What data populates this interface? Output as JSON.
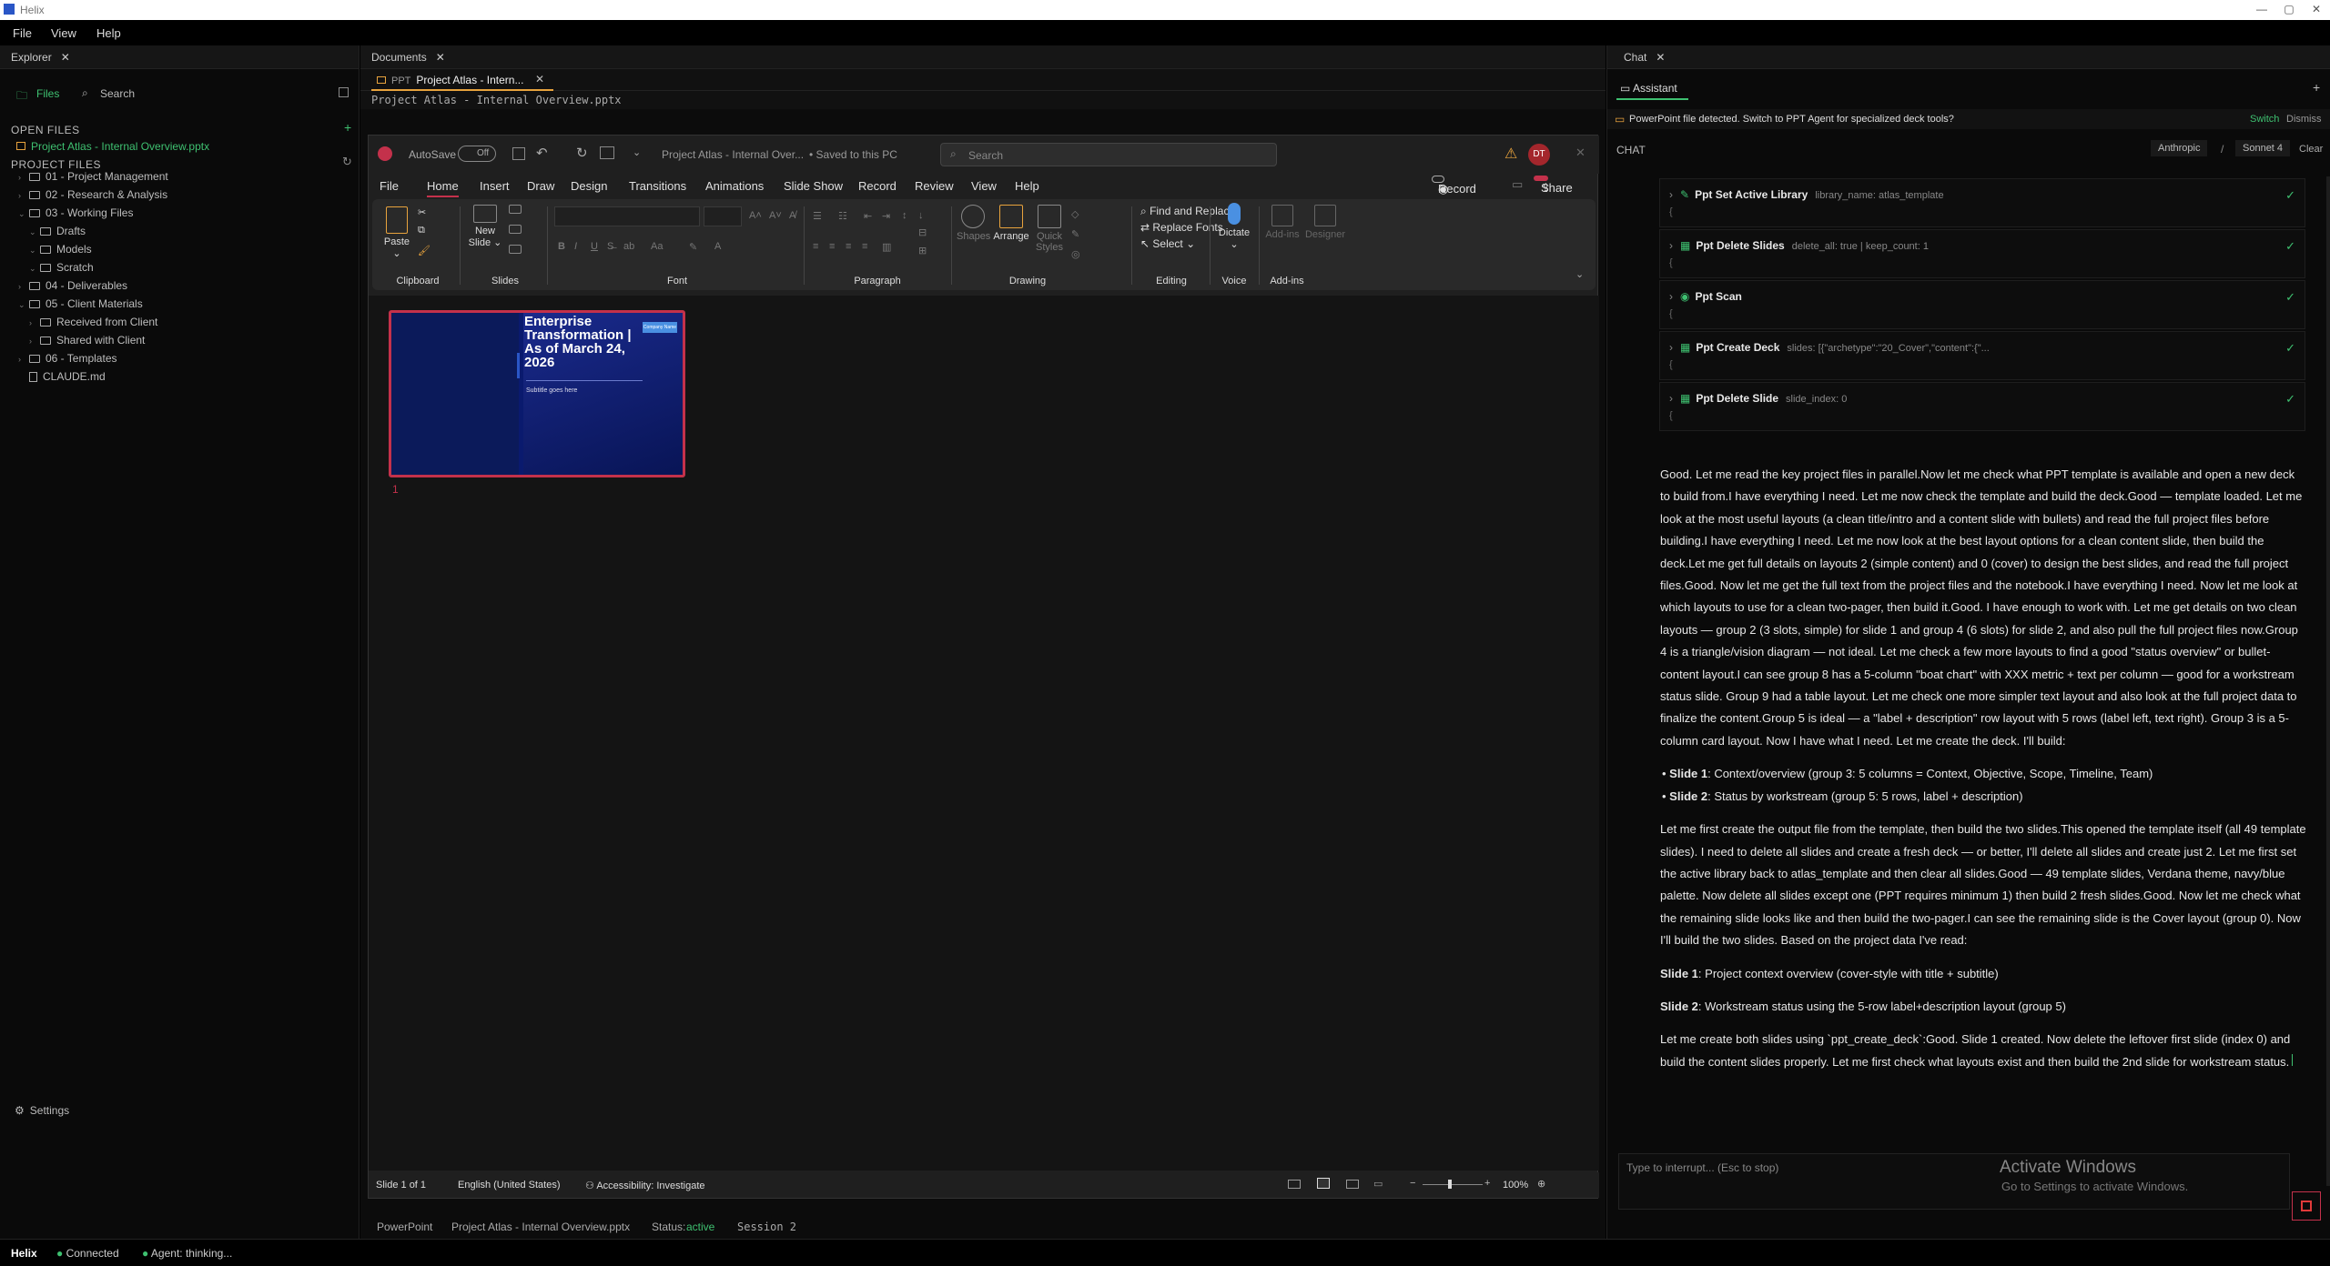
{
  "titlebar": {
    "title": "Helix",
    "minimize": "—",
    "maximize": "▢",
    "close": "✕"
  },
  "menu": [
    "File",
    "View",
    "Help"
  ],
  "explorer": {
    "tab": "Explorer",
    "files_tab": "Files",
    "search_tab": "Search",
    "open_files_label": "OPEN FILES",
    "open_file": "Project Atlas - Internal Overview.pptx",
    "project_files_label": "PROJECT FILES",
    "tree": [
      {
        "label": "01 - Project Management",
        "depth": 0,
        "type": "folder",
        "open": false
      },
      {
        "label": "02 - Research & Analysis",
        "depth": 0,
        "type": "folder",
        "open": false
      },
      {
        "label": "03 - Working Files",
        "depth": 0,
        "type": "folder",
        "open": true
      },
      {
        "label": "Drafts",
        "depth": 1,
        "type": "folder",
        "open": true
      },
      {
        "label": "Models",
        "depth": 1,
        "type": "folder",
        "open": true
      },
      {
        "label": "Scratch",
        "depth": 1,
        "type": "folder",
        "open": true
      },
      {
        "label": "04 - Deliverables",
        "depth": 0,
        "type": "folder",
        "open": false
      },
      {
        "label": "05 - Client Materials",
        "depth": 0,
        "type": "folder",
        "open": true
      },
      {
        "label": "Received from Client",
        "depth": 1,
        "type": "folder",
        "open": false
      },
      {
        "label": "Shared with Client",
        "depth": 1,
        "type": "folder",
        "open": false
      },
      {
        "label": "06 - Templates",
        "depth": 0,
        "type": "folder",
        "open": false
      },
      {
        "label": "CLAUDE.md",
        "depth": 0,
        "type": "file",
        "open": false
      }
    ],
    "settings": "Settings"
  },
  "documents": {
    "tab": "Documents",
    "doc_tab_prefix": "PPT",
    "doc_tab": "Project Atlas - Intern...",
    "path": "Project Atlas - Internal Overview.pptx"
  },
  "ppt": {
    "autosave": "AutoSave",
    "autosave_state": "Off",
    "doc_title": "Project Atlas - Internal Over...",
    "saved_state": "• Saved to this PC",
    "search_placeholder": "Search",
    "user_initials": "DT",
    "tabs": [
      "File",
      "Home",
      "Insert",
      "Draw",
      "Design",
      "Transitions",
      "Animations",
      "Slide Show",
      "Record",
      "Review",
      "View",
      "Help"
    ],
    "record_btn": "Record",
    "share_btn": "Share",
    "ribbon": {
      "paste": "Paste",
      "clipboard": "Clipboard",
      "new_slide": "New",
      "new_slide2": "Slide",
      "slides": "Slides",
      "font": "Font",
      "paragraph": "Paragraph",
      "shapes": "Shapes",
      "arrange": "Arrange",
      "quick_styles": "Quick",
      "quick_styles2": "Styles",
      "drawing": "Drawing",
      "find_replace": "Find and Replace",
      "replace_fonts": "Replace Fonts",
      "select": "Select",
      "editing": "Editing",
      "dictate": "Dictate",
      "voice": "Voice",
      "addins": "Add-ins",
      "addins_group": "Add-ins",
      "designer": "Designer"
    },
    "slide": {
      "number": "1",
      "title": "Enterprise Transformation | As of March 24, 2026",
      "subtitle": "Subtitle goes here",
      "tag": "Company Name"
    },
    "status": {
      "slide_of": "Slide 1 of 1",
      "language": "English (United States)",
      "accessibility": "Accessibility: Investigate",
      "zoom": "100%"
    }
  },
  "docstatus": {
    "app": "PowerPoint",
    "file": "Project Atlas - Internal Overview.pptx",
    "status_label": "Status:",
    "status_value": "active",
    "session": "Session 2"
  },
  "chat": {
    "tab": "Chat",
    "assistant_tab": "Assistant",
    "notice": "PowerPoint file detected. Switch to PPT Agent for specialized deck tools?",
    "switch": "Switch",
    "dismiss": "Dismiss",
    "chat_label": "CHAT",
    "provider": "Anthropic",
    "slash": "/",
    "model": "Sonnet 4",
    "clear": "Clear",
    "tools": [
      {
        "name": "Ppt Set Active Library",
        "params": "library_name: atlas_template",
        "icon": "✎"
      },
      {
        "name": "Ppt Delete Slides",
        "params": "delete_all: true | keep_count: 1",
        "icon": "▦"
      },
      {
        "name": "Ppt Scan",
        "params": "",
        "icon": "◉"
      },
      {
        "name": "Ppt Create Deck",
        "params": "slides: [{\"archetype\":\"20_Cover\",\"content\":{\"...",
        "icon": "▦"
      },
      {
        "name": "Ppt Delete Slide",
        "params": "slide_index: 0",
        "icon": "▦"
      }
    ],
    "brace": "{",
    "msg_p1": "Good. Let me read the key project files in parallel.Now let me check what PPT template is available and open a new deck to build from.I have everything I need. Let me now check the template and build the deck.Good — template loaded. Let me look at the most useful layouts (a clean title/intro and a content slide with bullets) and read the full project files before building.I have everything I need. Let me now look at the best layout options for a clean content slide, then build the deck.Let me get full details on layouts 2 (simple content) and 0 (cover) to design the best slides, and read the full project files.Good. Now let me get the full text from the project files and the notebook.I have everything I need. Now let me look at which layouts to use for a clean two-pager, then build it.Good. I have enough to work with. Let me get details on two clean layouts — group 2 (3 slots, simple) for slide 1 and group 4 (6 slots) for slide 2, and also pull the full project files now.Group 4 is a triangle/vision diagram — not ideal. Let me check a few more layouts to find a good \"status overview\" or bullet-content layout.I can see group 8 has a 5-column \"boat chart\" with XXX metric + text per column — good for a workstream status slide. Group 9 had a table layout. Let me check one more simpler text layout and also look at the full project data to finalize the content.Group 5 is ideal — a \"label + description\" row layout with 5 rows (label left, text right). Group 3 is a 5-column card layout. Now I have what I need. Let me create the deck. I'll build:",
    "bullet1_label": "Slide 1",
    "bullet1_text": ": Context/overview (group 3: 5 columns = Context, Objective, Scope, Timeline, Team)",
    "bullet2_label": "Slide 2",
    "bullet2_text": ": Status by workstream (group 5: 5 rows, label + description)",
    "msg_p2": "Let me first create the output file from the template, then build the two slides.This opened the template itself (all 49 template slides). I need to delete all slides and create a fresh deck — or better, I'll delete all slides and create just 2. Let me first set the active library back to atlas_template and then clear all slides.Good — 49 template slides, Verdana theme, navy/blue palette. Now delete all slides except one (PPT requires minimum 1) then build 2 fresh slides.Good. Now let me check what the remaining slide looks like and then build the two-pager.I can see the remaining slide is the Cover layout (group 0). Now I'll build the two slides. Based on the project data I've read:",
    "s1_label": "Slide 1",
    "s1_text": ": Project context overview (cover-style with title + subtitle)",
    "s2_label": "Slide 2",
    "s2_text": ": Workstream status using the 5-row label+description layout (group 5)",
    "msg_p3": "Let me create both slides using `ppt_create_deck`:Good. Slide 1 created. Now delete the leftover first slide (index 0) and build the content slides properly. Let me first check what layouts exist and then build the 2nd slide for workstream status.",
    "input_placeholder": "Type to interrupt... (Esc to stop)",
    "activate_title": "Activate Windows",
    "activate_sub": "Go to Settings to activate Windows."
  },
  "statusbar": {
    "app": "Helix",
    "connected": "Connected",
    "agent": "Agent: thinking..."
  },
  "colors": {
    "accent_green": "#3ec070",
    "accent_orange": "#e8a33d",
    "ppt_red": "#c4314b",
    "slide_navy": "#0a1a6e"
  }
}
